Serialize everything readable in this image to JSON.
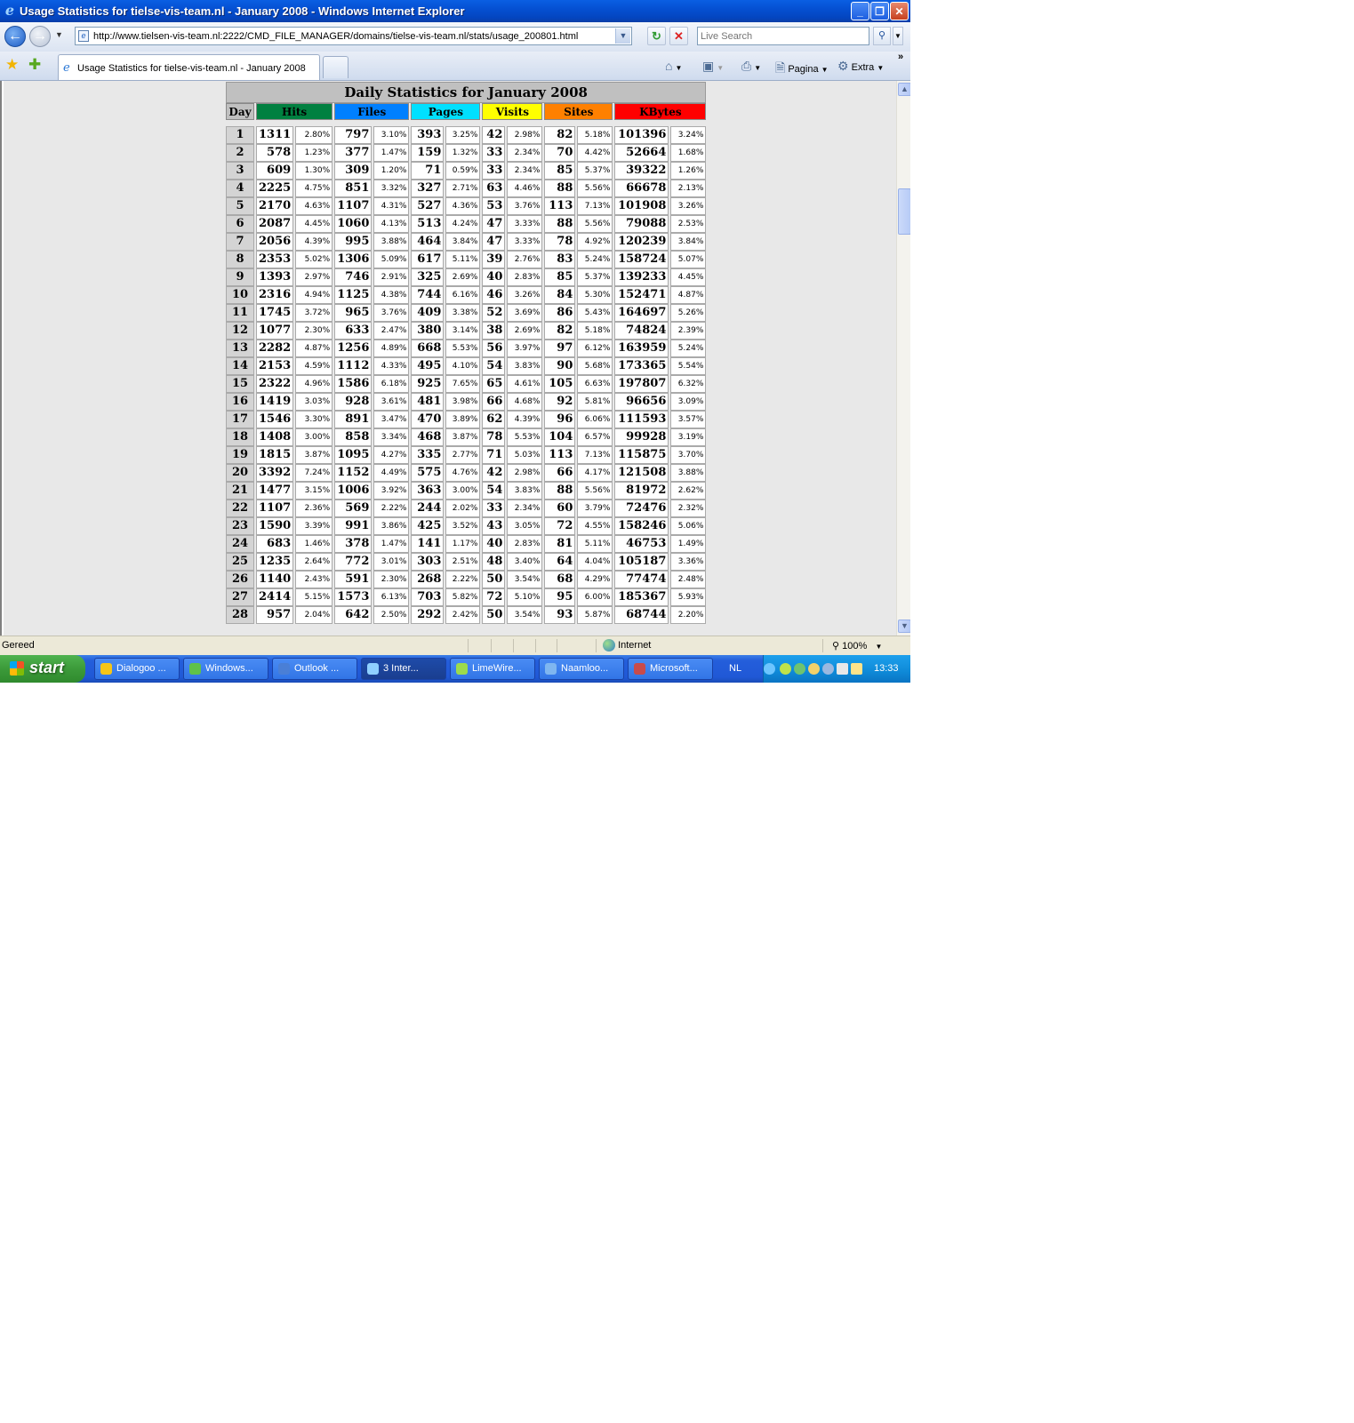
{
  "window": {
    "title": "Usage Statistics for tielse-vis-team.nl - January 2008 - Windows Internet Explorer",
    "minimize_glyph": "_",
    "restore_glyph": "❐",
    "close_glyph": "✕"
  },
  "address": {
    "url": "http://www.tielsen-vis-team.nl:2222/CMD_FILE_MANAGER/domains/tielse-vis-team.nl/stats/usage_200801.html",
    "search_placeholder": "Live Search"
  },
  "tabs": [
    {
      "label": "Usage Statistics for tielse-vis-team.nl - January 2008"
    }
  ],
  "commands": {
    "page": "Pagina",
    "tools": "Extra",
    "more": "»"
  },
  "stats": {
    "caption": "Daily Statistics for January 2008",
    "columns": [
      {
        "label": "Day",
        "color": "#c0c0c0"
      },
      {
        "label": "Hits",
        "color": "#008040"
      },
      {
        "label": "Files",
        "color": "#0080ff"
      },
      {
        "label": "Pages",
        "color": "#00e0ff"
      },
      {
        "label": "Visits",
        "color": "#ffff00"
      },
      {
        "label": "Sites",
        "color": "#ff8000"
      },
      {
        "label": "KBytes",
        "color": "#ff0000"
      }
    ],
    "rows": [
      [
        "1",
        "1311",
        "2.80%",
        "797",
        "3.10%",
        "393",
        "3.25%",
        "42",
        "2.98%",
        "82",
        "5.18%",
        "101396",
        "3.24%"
      ],
      [
        "2",
        "578",
        "1.23%",
        "377",
        "1.47%",
        "159",
        "1.32%",
        "33",
        "2.34%",
        "70",
        "4.42%",
        "52664",
        "1.68%"
      ],
      [
        "3",
        "609",
        "1.30%",
        "309",
        "1.20%",
        "71",
        "0.59%",
        "33",
        "2.34%",
        "85",
        "5.37%",
        "39322",
        "1.26%"
      ],
      [
        "4",
        "2225",
        "4.75%",
        "851",
        "3.32%",
        "327",
        "2.71%",
        "63",
        "4.46%",
        "88",
        "5.56%",
        "66678",
        "2.13%"
      ],
      [
        "5",
        "2170",
        "4.63%",
        "1107",
        "4.31%",
        "527",
        "4.36%",
        "53",
        "3.76%",
        "113",
        "7.13%",
        "101908",
        "3.26%"
      ],
      [
        "6",
        "2087",
        "4.45%",
        "1060",
        "4.13%",
        "513",
        "4.24%",
        "47",
        "3.33%",
        "88",
        "5.56%",
        "79088",
        "2.53%"
      ],
      [
        "7",
        "2056",
        "4.39%",
        "995",
        "3.88%",
        "464",
        "3.84%",
        "47",
        "3.33%",
        "78",
        "4.92%",
        "120239",
        "3.84%"
      ],
      [
        "8",
        "2353",
        "5.02%",
        "1306",
        "5.09%",
        "617",
        "5.11%",
        "39",
        "2.76%",
        "83",
        "5.24%",
        "158724",
        "5.07%"
      ],
      [
        "9",
        "1393",
        "2.97%",
        "746",
        "2.91%",
        "325",
        "2.69%",
        "40",
        "2.83%",
        "85",
        "5.37%",
        "139233",
        "4.45%"
      ],
      [
        "10",
        "2316",
        "4.94%",
        "1125",
        "4.38%",
        "744",
        "6.16%",
        "46",
        "3.26%",
        "84",
        "5.30%",
        "152471",
        "4.87%"
      ],
      [
        "11",
        "1745",
        "3.72%",
        "965",
        "3.76%",
        "409",
        "3.38%",
        "52",
        "3.69%",
        "86",
        "5.43%",
        "164697",
        "5.26%"
      ],
      [
        "12",
        "1077",
        "2.30%",
        "633",
        "2.47%",
        "380",
        "3.14%",
        "38",
        "2.69%",
        "82",
        "5.18%",
        "74824",
        "2.39%"
      ],
      [
        "13",
        "2282",
        "4.87%",
        "1256",
        "4.89%",
        "668",
        "5.53%",
        "56",
        "3.97%",
        "97",
        "6.12%",
        "163959",
        "5.24%"
      ],
      [
        "14",
        "2153",
        "4.59%",
        "1112",
        "4.33%",
        "495",
        "4.10%",
        "54",
        "3.83%",
        "90",
        "5.68%",
        "173365",
        "5.54%"
      ],
      [
        "15",
        "2322",
        "4.96%",
        "1586",
        "6.18%",
        "925",
        "7.65%",
        "65",
        "4.61%",
        "105",
        "6.63%",
        "197807",
        "6.32%"
      ],
      [
        "16",
        "1419",
        "3.03%",
        "928",
        "3.61%",
        "481",
        "3.98%",
        "66",
        "4.68%",
        "92",
        "5.81%",
        "96656",
        "3.09%"
      ],
      [
        "17",
        "1546",
        "3.30%",
        "891",
        "3.47%",
        "470",
        "3.89%",
        "62",
        "4.39%",
        "96",
        "6.06%",
        "111593",
        "3.57%"
      ],
      [
        "18",
        "1408",
        "3.00%",
        "858",
        "3.34%",
        "468",
        "3.87%",
        "78",
        "5.53%",
        "104",
        "6.57%",
        "99928",
        "3.19%"
      ],
      [
        "19",
        "1815",
        "3.87%",
        "1095",
        "4.27%",
        "335",
        "2.77%",
        "71",
        "5.03%",
        "113",
        "7.13%",
        "115875",
        "3.70%"
      ],
      [
        "20",
        "3392",
        "7.24%",
        "1152",
        "4.49%",
        "575",
        "4.76%",
        "42",
        "2.98%",
        "66",
        "4.17%",
        "121508",
        "3.88%"
      ],
      [
        "21",
        "1477",
        "3.15%",
        "1006",
        "3.92%",
        "363",
        "3.00%",
        "54",
        "3.83%",
        "88",
        "5.56%",
        "81972",
        "2.62%"
      ],
      [
        "22",
        "1107",
        "2.36%",
        "569",
        "2.22%",
        "244",
        "2.02%",
        "33",
        "2.34%",
        "60",
        "3.79%",
        "72476",
        "2.32%"
      ],
      [
        "23",
        "1590",
        "3.39%",
        "991",
        "3.86%",
        "425",
        "3.52%",
        "43",
        "3.05%",
        "72",
        "4.55%",
        "158246",
        "5.06%"
      ],
      [
        "24",
        "683",
        "1.46%",
        "378",
        "1.47%",
        "141",
        "1.17%",
        "40",
        "2.83%",
        "81",
        "5.11%",
        "46753",
        "1.49%"
      ],
      [
        "25",
        "1235",
        "2.64%",
        "772",
        "3.01%",
        "303",
        "2.51%",
        "48",
        "3.40%",
        "64",
        "4.04%",
        "105187",
        "3.36%"
      ],
      [
        "26",
        "1140",
        "2.43%",
        "591",
        "2.30%",
        "268",
        "2.22%",
        "50",
        "3.54%",
        "68",
        "4.29%",
        "77474",
        "2.48%"
      ],
      [
        "27",
        "2414",
        "5.15%",
        "1573",
        "6.13%",
        "703",
        "5.82%",
        "72",
        "5.10%",
        "95",
        "6.00%",
        "185367",
        "5.93%"
      ],
      [
        "28",
        "957",
        "2.04%",
        "642",
        "2.50%",
        "292",
        "2.42%",
        "50",
        "3.54%",
        "93",
        "5.87%",
        "68744",
        "2.20%"
      ]
    ]
  },
  "statusbar": {
    "text": "Gereed",
    "zone": "Internet",
    "zoom": "100%"
  },
  "taskbar": {
    "start_label": "start",
    "tasks": [
      {
        "label": "Dialogoo ...",
        "icon_color": "#f5c518"
      },
      {
        "label": "Windows...",
        "icon_color": "#5fc24a"
      },
      {
        "label": "Outlook ...",
        "icon_color": "#4a7fd6"
      },
      {
        "label": "3 Inter...",
        "icon_color": "#8fd0ff"
      },
      {
        "label": "LimeWire...",
        "icon_color": "#9cdb4c"
      },
      {
        "label": "Naamloo...",
        "icon_color": "#7fb6f0"
      },
      {
        "label": "Microsoft...",
        "icon_color": "#c84b4b"
      }
    ],
    "language": "NL",
    "clock": "13:33"
  }
}
